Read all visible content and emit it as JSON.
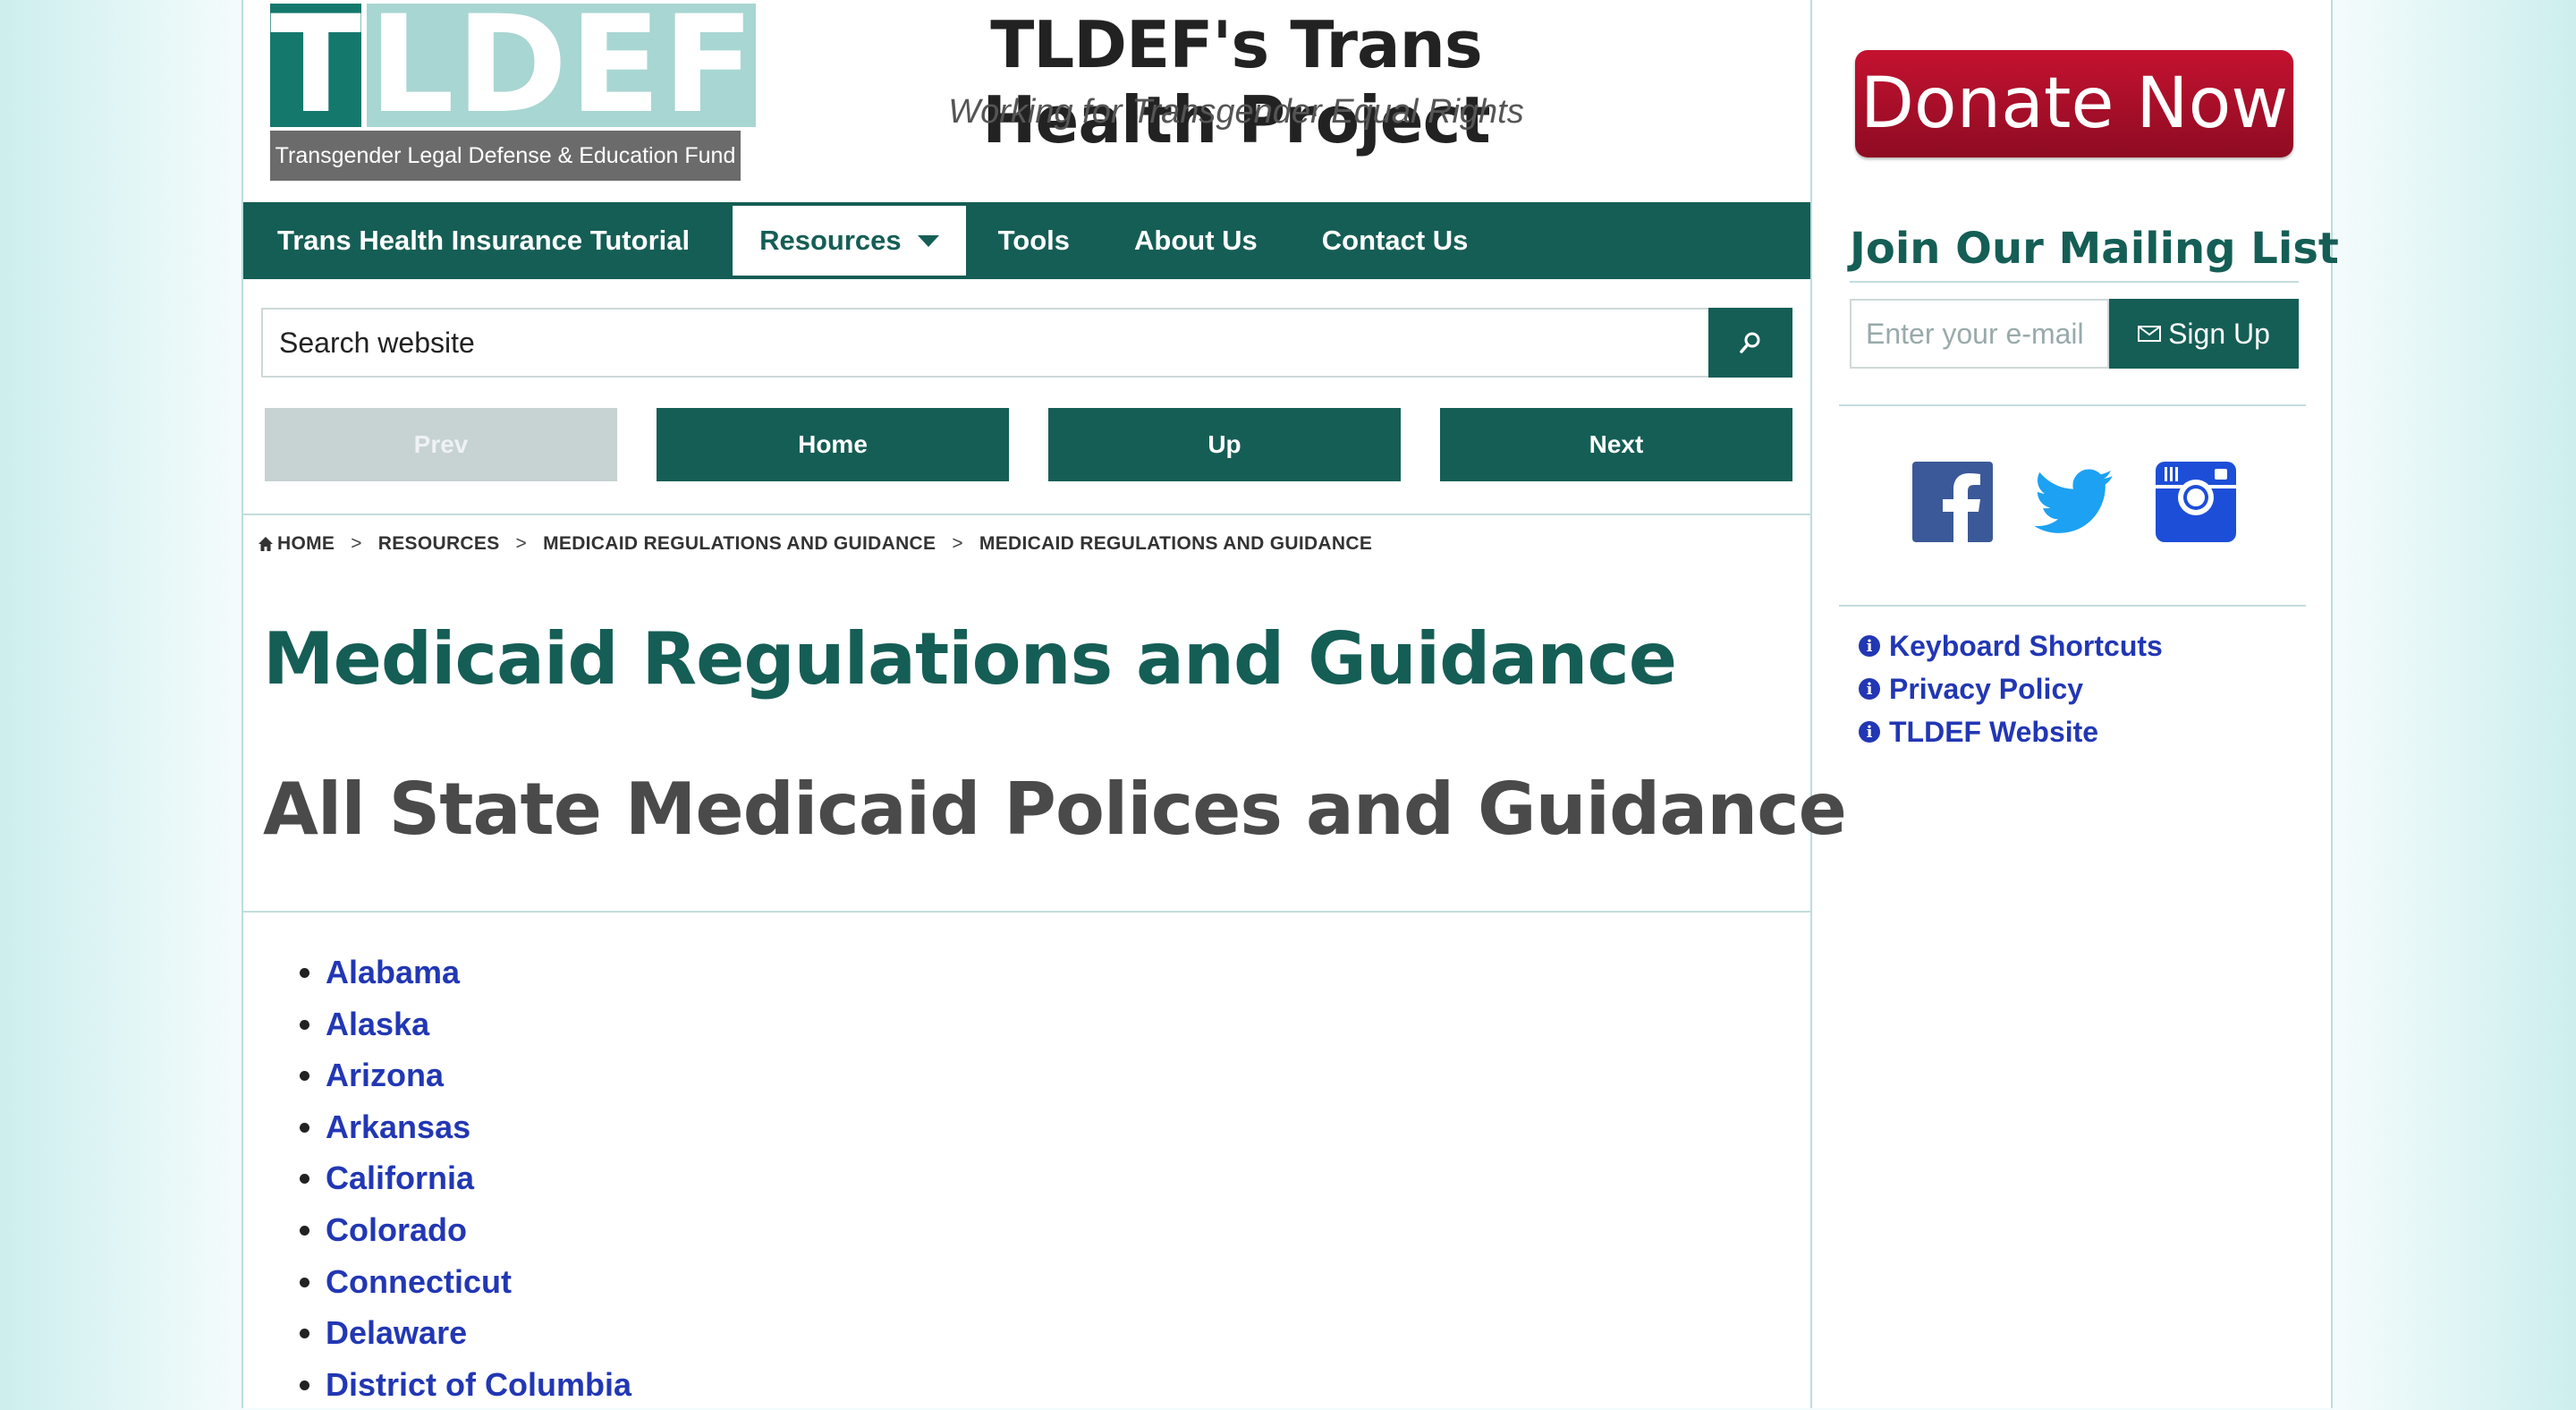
{
  "logo": {
    "letter_t": "T",
    "letters_rest": "LDEF",
    "subtitle": "Transgender Legal Defense & Education Fund"
  },
  "header": {
    "title": "TLDEF's Trans Health Project",
    "tagline": "Working for Transgender Equal Rights"
  },
  "nav": {
    "items": [
      {
        "label": "Trans Health Insurance Tutorial"
      },
      {
        "label": "Resources",
        "active": true
      },
      {
        "label": "Tools"
      },
      {
        "label": "About Us"
      },
      {
        "label": "Contact Us"
      }
    ]
  },
  "search": {
    "placeholder": "Search website"
  },
  "pager": {
    "prev": "Prev",
    "home": "Home",
    "up": "Up",
    "next": "Next"
  },
  "breadcrumb": {
    "items": [
      "HOME",
      "RESOURCES",
      "MEDICAID REGULATIONS AND GUIDANCE",
      "MEDICAID REGULATIONS AND GUIDANCE"
    ],
    "separator": ">"
  },
  "main": {
    "title": "Medicaid Regulations and Guidance",
    "subtitle": "All State Medicaid Polices and Guidance",
    "states": [
      "Alabama",
      "Alaska",
      "Arizona",
      "Arkansas",
      "California",
      "Colorado",
      "Connecticut",
      "Delaware",
      "District of Columbia"
    ]
  },
  "sidebar": {
    "donate_label": "Donate Now",
    "mailing_title": "Join Our Mailing List",
    "email_placeholder": "Enter your e-mail",
    "signup_label": "Sign Up",
    "social": [
      "facebook-icon",
      "twitter-icon",
      "instagram-icon"
    ],
    "links": [
      "Keyboard Shortcuts",
      "Privacy Policy",
      "TLDEF Website"
    ]
  },
  "colors": {
    "brand_green": "#155e55",
    "link_blue": "#2237b4",
    "donate_red": "#b0102a",
    "logo_teal": "#15786d"
  }
}
